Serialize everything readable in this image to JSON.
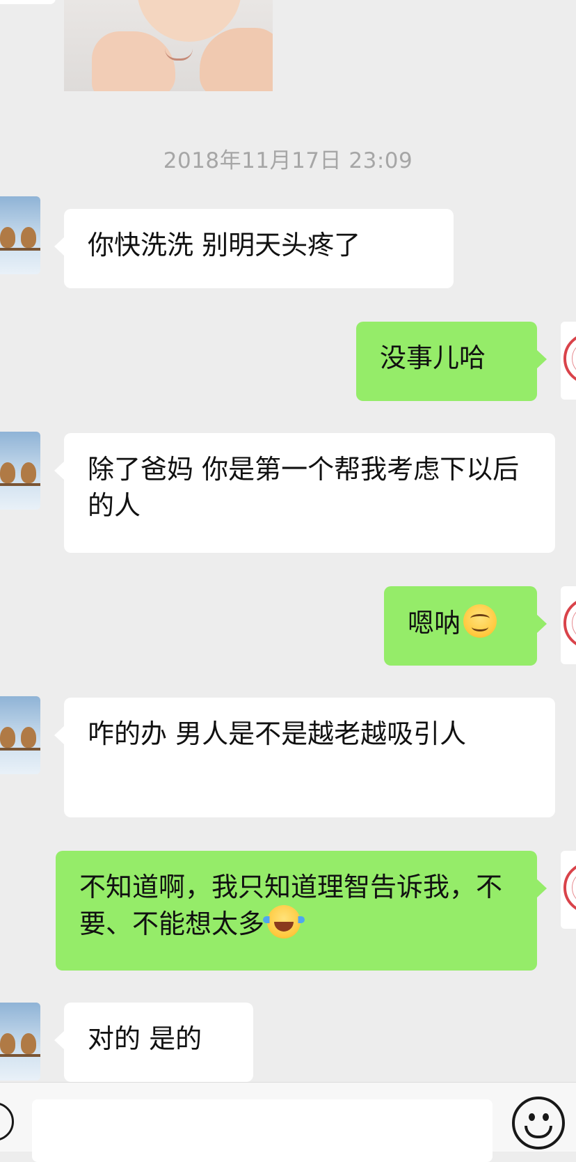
{
  "chat": {
    "timestamp": "2018年11月17日 23:09",
    "messages": [
      {
        "side": "left",
        "text": "你快洗洗 别明天头疼了"
      },
      {
        "side": "right",
        "text": "没事儿哈"
      },
      {
        "side": "left",
        "text": "除了爸妈 你是第一个帮我考虑下以后的人"
      },
      {
        "side": "right",
        "text": "嗯呐",
        "emoji": "smiling-face-icon"
      },
      {
        "side": "left",
        "text": "咋的办 男人是不是越老越吸引人"
      },
      {
        "side": "right",
        "text": "不知道啊，我只知道理智告诉我，不要、不能想太多",
        "emoji": "tears-of-joy-icon"
      },
      {
        "side": "left",
        "text": "对的 是的"
      }
    ]
  },
  "colors": {
    "background": "#ededed",
    "bubble_left": "#ffffff",
    "bubble_right": "#95ec69",
    "timestamp": "#a6a6a6"
  },
  "input_bar": {
    "value": "",
    "icons": [
      "voice-icon",
      "emoji-icon"
    ]
  }
}
